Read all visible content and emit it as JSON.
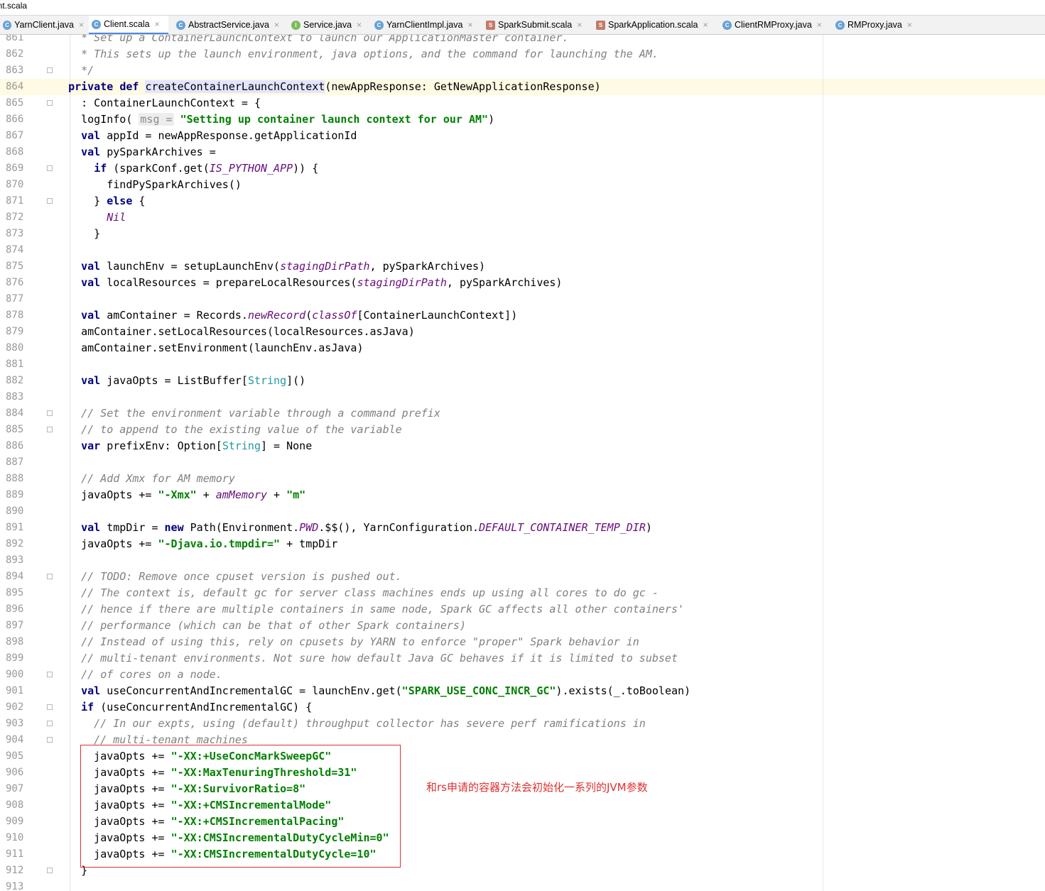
{
  "window": {
    "title": "ent.scala"
  },
  "tabs": [
    {
      "label": "YarnClient.java",
      "icon": "java-class-icon"
    },
    {
      "label": "Client.scala",
      "icon": "scala-class-icon",
      "active": true
    },
    {
      "label": "AbstractService.java",
      "icon": "java-class-icon"
    },
    {
      "label": "Service.java",
      "icon": "java-interface-icon"
    },
    {
      "label": "YarnClientImpl.java",
      "icon": "java-class-icon"
    },
    {
      "label": "SparkSubmit.scala",
      "icon": "scala-object-icon"
    },
    {
      "label": "SparkApplication.scala",
      "icon": "scala-object-icon"
    },
    {
      "label": "ClientRMProxy.java",
      "icon": "java-class-icon"
    },
    {
      "label": "RMProxy.java",
      "icon": "java-class-icon"
    }
  ],
  "tab_close_glyph": "×",
  "editor": {
    "current_line": "864",
    "lines": [
      {
        "n": "861",
        "t": "    * Set up a ContainerLaunchContext to launch our ApplicationMaster container."
      },
      {
        "n": "862",
        "t": "    * This sets up the launch environment, java options, and the command for launching the AM."
      },
      {
        "n": "863",
        "t": "    */"
      },
      {
        "n": "864",
        "t": "  private def createContainerLaunchContext(newAppResponse: GetNewApplicationResponse)"
      },
      {
        "n": "865",
        "t": "    : ContainerLaunchContext = {"
      },
      {
        "n": "866",
        "t": "    logInfo( msg = \"Setting up container launch context for our AM\")"
      },
      {
        "n": "867",
        "t": "    val appId = newAppResponse.getApplicationId"
      },
      {
        "n": "868",
        "t": "    val pySparkArchives ="
      },
      {
        "n": "869",
        "t": "      if (sparkConf.get(IS_PYTHON_APP)) {"
      },
      {
        "n": "870",
        "t": "        findPySparkArchives()"
      },
      {
        "n": "871",
        "t": "      } else {"
      },
      {
        "n": "872",
        "t": "        Nil"
      },
      {
        "n": "873",
        "t": "      }"
      },
      {
        "n": "874",
        "t": ""
      },
      {
        "n": "875",
        "t": "    val launchEnv = setupLaunchEnv(stagingDirPath, pySparkArchives)"
      },
      {
        "n": "876",
        "t": "    val localResources = prepareLocalResources(stagingDirPath, pySparkArchives)"
      },
      {
        "n": "877",
        "t": ""
      },
      {
        "n": "878",
        "t": "    val amContainer = Records.newRecord(classOf[ContainerLaunchContext])"
      },
      {
        "n": "879",
        "t": "    amContainer.setLocalResources(localResources.asJava)"
      },
      {
        "n": "880",
        "t": "    amContainer.setEnvironment(launchEnv.asJava)"
      },
      {
        "n": "881",
        "t": ""
      },
      {
        "n": "882",
        "t": "    val javaOpts = ListBuffer[String]()"
      },
      {
        "n": "883",
        "t": ""
      },
      {
        "n": "884",
        "t": "    // Set the environment variable through a command prefix"
      },
      {
        "n": "885",
        "t": "    // to append to the existing value of the variable"
      },
      {
        "n": "886",
        "t": "    var prefixEnv: Option[String] = None"
      },
      {
        "n": "887",
        "t": ""
      },
      {
        "n": "888",
        "t": "    // Add Xmx for AM memory"
      },
      {
        "n": "889",
        "t": "    javaOpts += \"-Xmx\" + amMemory + \"m\""
      },
      {
        "n": "890",
        "t": ""
      },
      {
        "n": "891",
        "t": "    val tmpDir = new Path(Environment.PWD.$$(), YarnConfiguration.DEFAULT_CONTAINER_TEMP_DIR)"
      },
      {
        "n": "892",
        "t": "    javaOpts += \"-Djava.io.tmpdir=\" + tmpDir"
      },
      {
        "n": "893",
        "t": ""
      },
      {
        "n": "894",
        "t": "    // TODO: Remove once cpuset version is pushed out."
      },
      {
        "n": "895",
        "t": "    // The context is, default gc for server class machines ends up using all cores to do gc -"
      },
      {
        "n": "896",
        "t": "    // hence if there are multiple containers in same node, Spark GC affects all other containers'"
      },
      {
        "n": "897",
        "t": "    // performance (which can be that of other Spark containers)"
      },
      {
        "n": "898",
        "t": "    // Instead of using this, rely on cpusets by YARN to enforce \"proper\" Spark behavior in"
      },
      {
        "n": "899",
        "t": "    // multi-tenant environments. Not sure how default Java GC behaves if it is limited to subset"
      },
      {
        "n": "900",
        "t": "    // of cores on a node."
      },
      {
        "n": "901",
        "t": "    val useConcurrentAndIncrementalGC = launchEnv.get(\"SPARK_USE_CONC_INCR_GC\").exists(_.toBoolean)"
      },
      {
        "n": "902",
        "t": "    if (useConcurrentAndIncrementalGC) {"
      },
      {
        "n": "903",
        "t": "      // In our expts, using (default) throughput collector has severe perf ramifications in"
      },
      {
        "n": "904",
        "t": "      // multi-tenant machines"
      },
      {
        "n": "905",
        "t": "      javaOpts += \"-XX:+UseConcMarkSweepGC\""
      },
      {
        "n": "906",
        "t": "      javaOpts += \"-XX:MaxTenuringThreshold=31\""
      },
      {
        "n": "907",
        "t": "      javaOpts += \"-XX:SurvivorRatio=8\""
      },
      {
        "n": "908",
        "t": "      javaOpts += \"-XX:+CMSIncrementalMode\""
      },
      {
        "n": "909",
        "t": "      javaOpts += \"-XX:+CMSIncrementalPacing\""
      },
      {
        "n": "910",
        "t": "      javaOpts += \"-XX:CMSIncrementalDutyCycleMin=0\""
      },
      {
        "n": "911",
        "t": "      javaOpts += \"-XX:CMSIncrementalDutyCycle=10\""
      },
      {
        "n": "912",
        "t": "    }"
      },
      {
        "n": "913",
        "t": ""
      }
    ]
  },
  "annotation": {
    "text": "和rs申请的容器方法会初始化一系列的JVM参数",
    "color": "#e03030"
  },
  "colors": {
    "keyword": "#000080",
    "string": "#008000",
    "comment": "#808080",
    "italic_member": "#660e7a",
    "type_param": "#20999d",
    "current_line_bg": "#fffae3",
    "active_tab_underline": "#4a86e8"
  }
}
